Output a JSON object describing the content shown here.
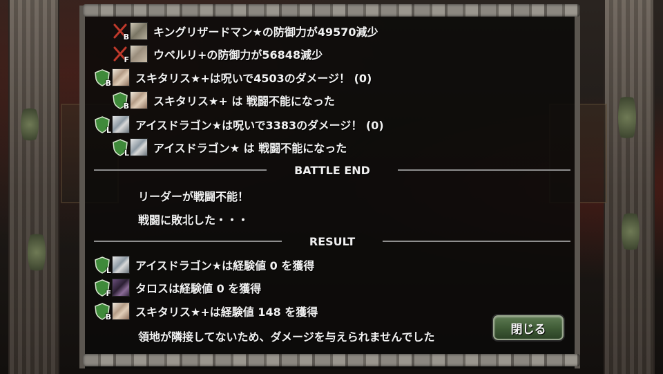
{
  "battle_log": [
    {
      "marker": "slash",
      "grade": "B",
      "portrait": "lizard",
      "text": "キングリザードマン★の防御力が49570減少"
    },
    {
      "marker": "slash",
      "grade": "F",
      "portrait": "uperi",
      "text": "ウペルリ+の防御力が56848減少"
    },
    {
      "marker": "shield",
      "grade": "B",
      "portrait": "skitaris",
      "text": "スキタリス★+は呪いで4503のダメージ！ (0)"
    },
    {
      "marker": "shield",
      "grade": "B",
      "portrait": "skitaris",
      "text": "スキタリス★+ は 戦闘不能になった"
    },
    {
      "marker": "shield",
      "grade": "L",
      "portrait": "dragon",
      "text": "アイスドラゴン★は呪いで3383のダメージ！ (0)"
    },
    {
      "marker": "shield",
      "grade": "L",
      "portrait": "dragon",
      "text": "アイスドラゴン★ は 戦闘不能になった"
    }
  ],
  "battle_end": {
    "heading": "BATTLE END",
    "lines": [
      "リーダーが戦闘不能！",
      "戦闘に敗北した・・・"
    ]
  },
  "result": {
    "heading": "RESULT",
    "entries": [
      {
        "marker": "shield",
        "grade": "L",
        "portrait": "dragon",
        "text": "アイスドラゴン★は経験値 0 を獲得"
      },
      {
        "marker": "shield",
        "grade": "F",
        "portrait": "talos",
        "text": "タロスは経験値 0 を獲得"
      },
      {
        "marker": "shield",
        "grade": "B",
        "portrait": "skitaris",
        "text": "スキタリス★+は経験値 148 を獲得"
      }
    ],
    "note": "領地が隣接してないため、ダメージを与えられませんでした"
  },
  "close_button": {
    "label": "閉じる"
  },
  "colors": {
    "shield_green": "#3f8a3a",
    "slash_red": "#c0392b",
    "button_green": "#3e5a35",
    "text": "#f2f2f2"
  }
}
